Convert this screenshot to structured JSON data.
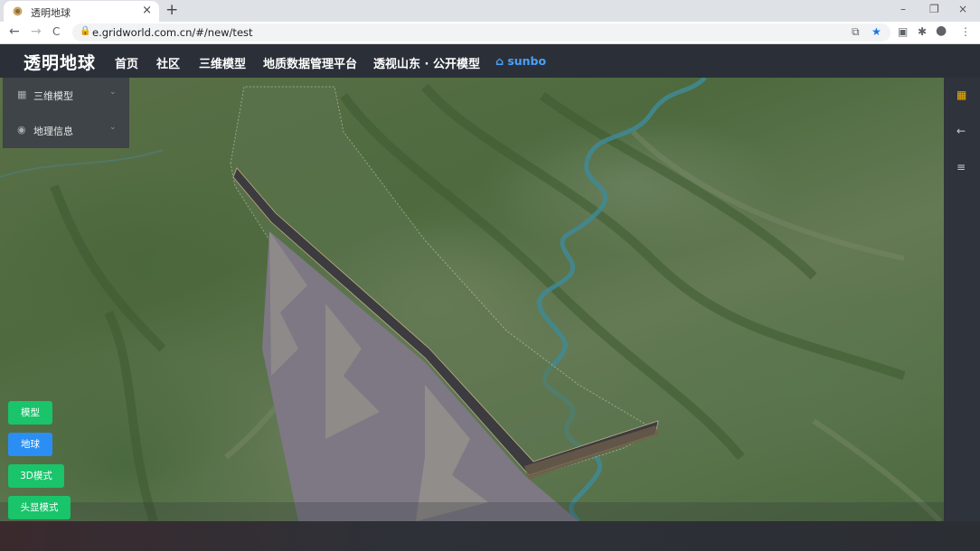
{
  "tab": {
    "title": "透明地球",
    "close": "×",
    "new": "+"
  },
  "window_controls": {
    "minimize": "–",
    "restore": "❐",
    "close": "×"
  },
  "address_bar": {
    "back": "←",
    "forward": "→",
    "reload": "C",
    "url": "e.gridworld.com.cn/#/new/test"
  },
  "app": {
    "brand": "透明地球",
    "nav": [
      "首页",
      "社区",
      "三维模型",
      "地质数据管理平台",
      "透视山东 · 公开模型"
    ],
    "user": "sunbo"
  },
  "left_menu": [
    {
      "label": "三维模型",
      "icon": "grid-icon"
    },
    {
      "label": "地理信息",
      "icon": "location-pin-icon"
    }
  ],
  "mode_buttons": [
    {
      "label": "模型",
      "color": "#19c46a"
    },
    {
      "label": "地球",
      "color": "#2b8ef5"
    },
    {
      "label": "3D模式",
      "color": "#19c46a"
    },
    {
      "label": "头显模式",
      "color": "#19c46a"
    }
  ],
  "right_rail": {
    "icons": [
      "grid-icon",
      "arrow-left-icon",
      "menu-icon"
    ],
    "accent": "#f5b400"
  }
}
